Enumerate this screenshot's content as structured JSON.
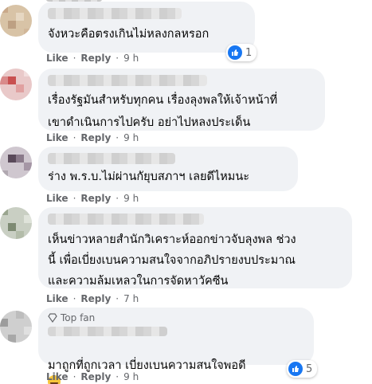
{
  "comments": [
    {
      "text": "จังหวะคือตรงเกินไม่หลงกลหรอก",
      "like_label": "Like",
      "reply_label": "Reply",
      "time": "9 h",
      "reactions": "1"
    },
    {
      "text": "เรื่องรัฐมันสำหรับทุกคน เรื่องลุงพลให้เจ้าหน้าที่\nเขาดำเนินการไปครับ อย่าไปหลงประเด็น",
      "like_label": "Like",
      "reply_label": "Reply",
      "time": "9 h"
    },
    {
      "text": "ร่าง พ.ร.บ.ไม่ผ่านกัยุบสภาฯ เลยดีไหมนะ",
      "like_label": "Like",
      "reply_label": "Reply",
      "time": "9 h"
    },
    {
      "text": "เห็นข่าวหลายสำนักวิเคราะห์ออกข่าวจับลุงพล ช่วง\nนี้ เพื่อเบี่ยงเบนความสนใจจากอภิปรายงบประมาณ\nและความล้มเหลวในการจัดหาวัคซีน",
      "like_label": "Like",
      "reply_label": "Reply",
      "time": "7 h"
    },
    {
      "badge": "Top fan",
      "text": "มาถูกที่ถูกเวลา เบี่ยงเบนความสนใจพอดี",
      "like_label": "Like",
      "reply_label": "Reply",
      "time": "9 h",
      "reactions": "5"
    }
  ],
  "colors": {
    "bubble": "#f0f2f5",
    "meta": "#65676b",
    "like_blue": "#1877f2"
  },
  "icons": [
    "like-icon",
    "top-fan-badge-icon",
    "laughing-emoji-icon"
  ]
}
